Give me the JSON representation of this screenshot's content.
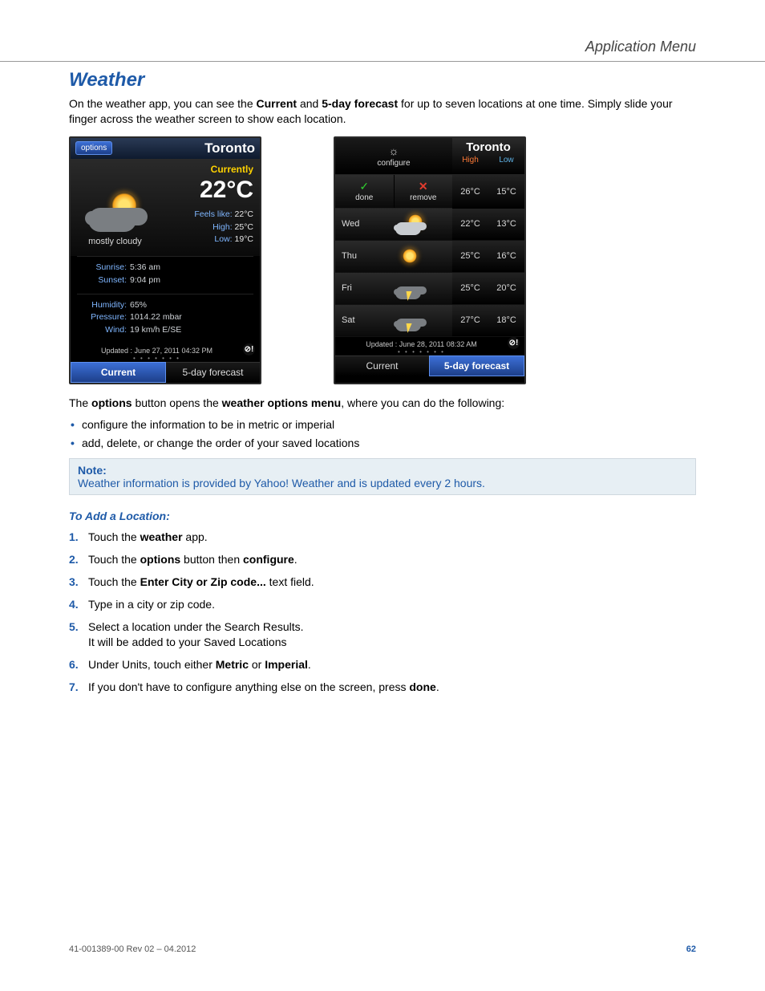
{
  "header": {
    "section": "Application Menu"
  },
  "title": "Weather",
  "intro": {
    "pre": "On the weather app, you can see the ",
    "b1": "Current",
    "mid": " and ",
    "b2": "5-day forecast",
    "post": " for up to seven locations at one time. Simply slide your finger across the weather screen to show each location."
  },
  "screen_current": {
    "options_label": "options",
    "city": "Toronto",
    "currently_label": "Currently",
    "temp": "22°C",
    "condition": "mostly cloudy",
    "feels_like_label": "Feels like:",
    "feels_like": "22°C",
    "high_label": "High:",
    "high": "25°C",
    "low_label": "Low:",
    "low": "19°C",
    "sunrise_label": "Sunrise:",
    "sunrise": "5:36 am",
    "sunset_label": "Sunset:",
    "sunset": "9:04 pm",
    "humidity_label": "Humidity:",
    "humidity": "65%",
    "pressure_label": "Pressure:",
    "pressure": "1014.22 mbar",
    "wind_label": "Wind:",
    "wind": "19 km/h E/SE",
    "updated": "Updated : June 27, 2011 04:32 PM",
    "tab_current": "Current",
    "tab_forecast": "5-day forecast"
  },
  "screen_forecast": {
    "configure_label": "configure",
    "city": "Toronto",
    "high_label": "High",
    "low_label": "Low",
    "done_label": "done",
    "remove_label": "remove",
    "today_high": "26°C",
    "today_low": "15°C",
    "days": [
      {
        "day": "Wed",
        "high": "22°C",
        "low": "13°C",
        "icon": "partly-cloudy"
      },
      {
        "day": "Thu",
        "high": "25°C",
        "low": "16°C",
        "icon": "sunny"
      },
      {
        "day": "Fri",
        "high": "25°C",
        "low": "20°C",
        "icon": "thunder"
      },
      {
        "day": "Sat",
        "high": "27°C",
        "low": "18°C",
        "icon": "thunder"
      }
    ],
    "updated": "Updated : June 28, 2011 08:32 AM",
    "tab_current": "Current",
    "tab_forecast": "5-day forecast"
  },
  "options_para": {
    "pre": "The ",
    "b1": "options",
    "mid": " button opens the ",
    "b2": "weather options menu",
    "post": ", where you can do the following:"
  },
  "bullets": [
    "configure the information to be in metric or imperial",
    "add, delete, or change the order of your saved locations"
  ],
  "note": {
    "title": "Note:",
    "body": "Weather information is provided by Yahoo! Weather and is updated every 2 hours."
  },
  "howto_title": "To Add a Location:",
  "steps": {
    "s1": {
      "pre": "Touch the ",
      "b1": "weather",
      "post": " app."
    },
    "s2": {
      "pre": "Touch the ",
      "b1": "options",
      "mid": " button then ",
      "b2": "configure",
      "post": "."
    },
    "s3": {
      "pre": "Touch the ",
      "b1": "Enter City or Zip code...",
      "post": " text field."
    },
    "s4": {
      "text": "Type in a city or zip code."
    },
    "s5": {
      "l1": "Select a location under the Search Results.",
      "l2": "It will be added to your Saved Locations"
    },
    "s6": {
      "pre": "Under Units, touch either ",
      "b1": "Metric",
      "mid": " or ",
      "b2": "Imperial",
      "post": "."
    },
    "s7": {
      "pre": "If you don't have to configure anything else on the screen, press ",
      "b1": "done",
      "post": "."
    }
  },
  "footer": {
    "rev": "41-001389-00 Rev 02 – 04.2012",
    "page": "62"
  }
}
